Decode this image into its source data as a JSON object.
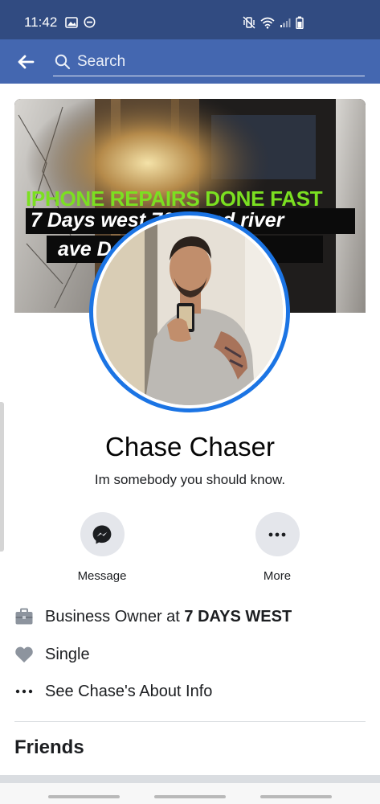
{
  "status_bar": {
    "time": "11:42",
    "left_icons": [
      "image-icon",
      "do-not-disturb-icon"
    ],
    "right_icons": [
      "mute-vibrate-icon",
      "wifi-icon",
      "signal-icon",
      "battery-icon"
    ]
  },
  "nav": {
    "back_icon": "back-arrow-icon",
    "search_placeholder": "Search"
  },
  "cover": {
    "line1": "IPHONE REPAIRS DONE FAST",
    "line2": "7 Days west     70 grand river",
    "line3": "ave D              8585"
  },
  "profile": {
    "name": "Chase Chaser",
    "bio": "Im somebody you should know."
  },
  "actions": {
    "message_label": "Message",
    "more_label": "More"
  },
  "info": {
    "work_prefix": "Business Owner at ",
    "work_place": "7 DAYS WEST",
    "relationship": "Single",
    "about_link": "See Chase's About Info"
  },
  "friends": {
    "heading": "Friends"
  },
  "colors": {
    "status_bar": "#314b81",
    "nav_bar": "#4467b0",
    "avatar_ring": "#1b74e4",
    "cover_green_text": "#7be021"
  }
}
